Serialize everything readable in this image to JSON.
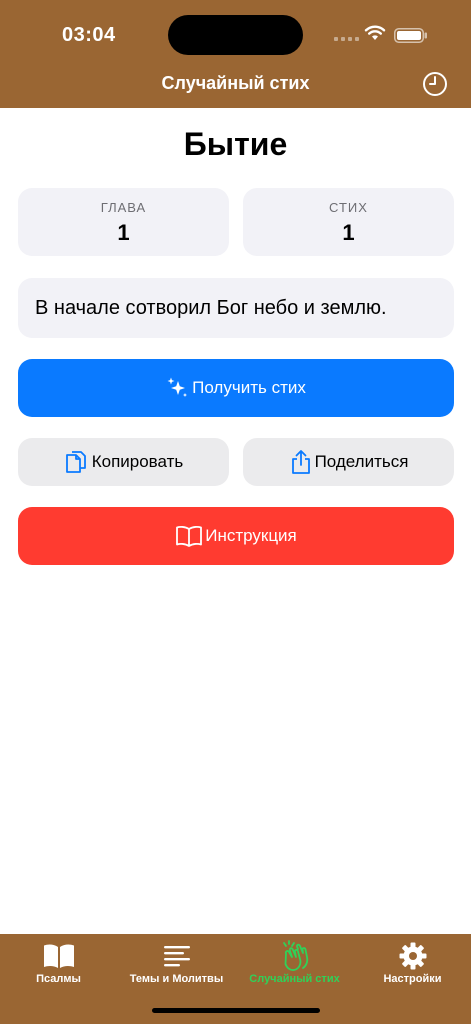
{
  "status_bar": {
    "time": "03:04"
  },
  "nav": {
    "title": "Случайный стих",
    "history_icon": "clock-icon"
  },
  "verse": {
    "book": "Бытие",
    "chapter_label": "ГЛАВА",
    "chapter_value": "1",
    "verse_label": "СТИХ",
    "verse_value": "1",
    "text": "В начале сотворил Бог небо и землю."
  },
  "actions": {
    "get_verse": "Получить стих",
    "copy": "Копировать",
    "share": "Поделиться",
    "instructions": "Инструкция"
  },
  "tabs": [
    {
      "label": "Псалмы",
      "icon": "book-icon"
    },
    {
      "label": "Темы и Молитвы",
      "icon": "lines-icon"
    },
    {
      "label": "Случайный стих",
      "icon": "hands-clap-icon",
      "active": true
    },
    {
      "label": "Настройки",
      "icon": "gear-icon"
    }
  ],
  "colors": {
    "header": "#9a6633",
    "primary": "#0a7aff",
    "danger": "#ff3b30",
    "active_tab": "#30d158",
    "card": "#f2f2f7"
  }
}
